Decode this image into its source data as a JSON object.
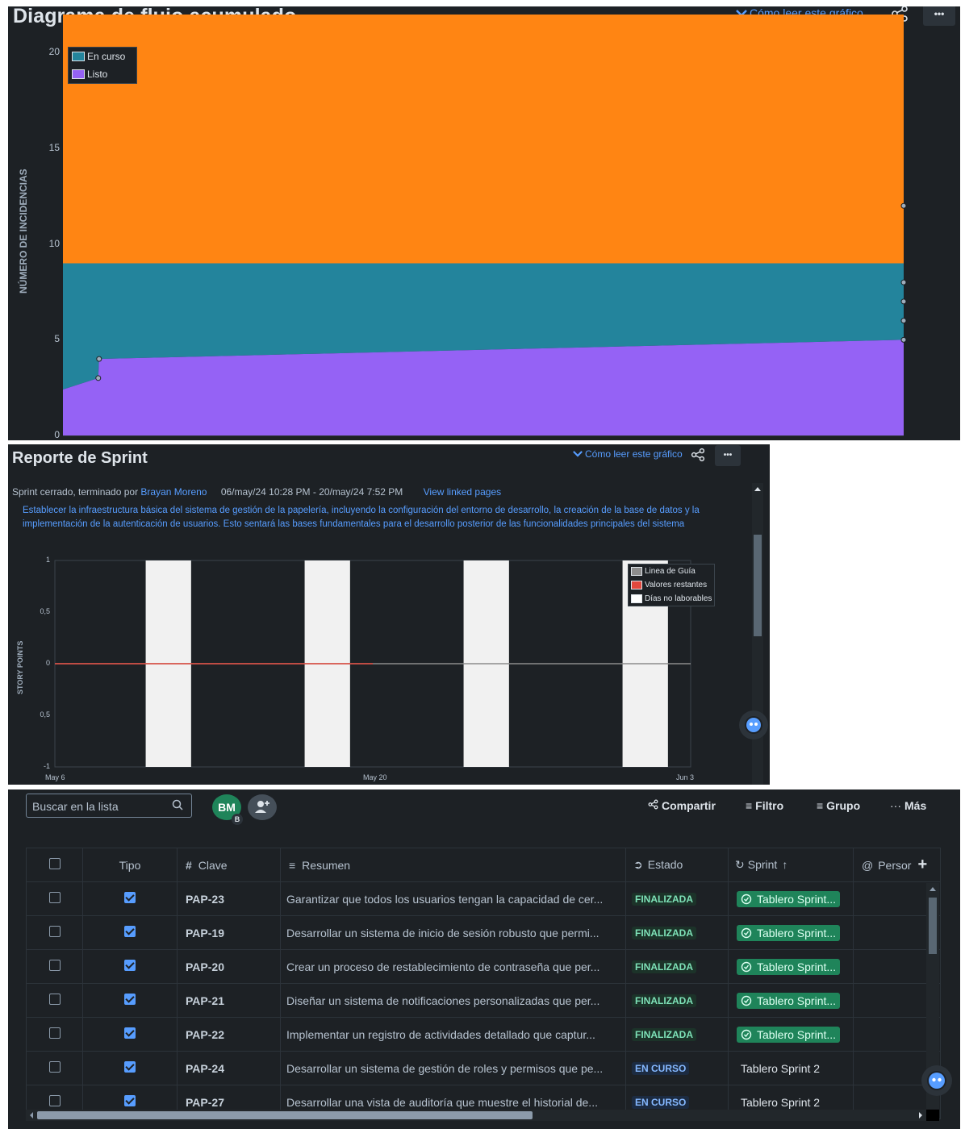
{
  "cfd": {
    "title": "Diagrama de flujo acumulado",
    "how_to_read": "Cómo leer este gráfico",
    "more_label": "•••",
    "ylabel": "NÚMERO DE INCIDENCIAS",
    "legend": [
      {
        "label": "En curso",
        "color": "#23849c"
      },
      {
        "label": "Listo",
        "color": "#9562f5"
      }
    ],
    "share_icon": "share-icon",
    "chart_data": {
      "type": "area",
      "ylabel": "NÚMERO DE INCIDENCIAS",
      "ylim": [
        0,
        22
      ],
      "yticks": [
        "0",
        "5",
        "10",
        "15",
        "20"
      ],
      "series": [
        {
          "name": "Listo",
          "color": "#9562f5",
          "values": [
            2.4,
            3,
            4,
            5
          ]
        },
        {
          "name": "En curso",
          "color": "#23849c",
          "values": [
            9,
            9,
            9,
            9
          ]
        },
        {
          "color": "#ff8513",
          "values": [
            22,
            22,
            22,
            22
          ]
        }
      ],
      "x_fraction": [
        0,
        0.042,
        0.043,
        1
      ],
      "stack_tops": {
        "listo": [
          2.4,
          3,
          4,
          5
        ],
        "en_curso": [
          9,
          9,
          9,
          9
        ],
        "top": [
          22,
          22,
          22,
          22
        ]
      },
      "grid": false,
      "legend_position": "top-left"
    }
  },
  "sprint_report": {
    "title": "Reporte de Sprint",
    "how_to_read": "Cómo leer este gráfico",
    "more_label": "•••",
    "status_prefix": "Sprint cerrado, terminado por",
    "closed_by": "Brayan Moreno",
    "dates": "06/may/24 10:28 PM - 20/may/24 7:52 PM",
    "linked_pages": "View linked pages",
    "goal": "Establecer la infraestructura básica del sistema de gestión de la papelería, incluyendo la configuración del entorno de desarrollo, la creación de la base de datos y la implementación de la autenticación de usuarios. Esto sentará las bases fundamentales para el desarrollo posterior de las funcionalidades principales del sistema",
    "ylabel": "STORY POINTS",
    "legend": [
      {
        "label": "Linea de Guía",
        "color": "#8c8c8c"
      },
      {
        "label": "Valores restantes",
        "color": "#e2483d"
      },
      {
        "label": "Días no laborables",
        "color": "#ffffff"
      }
    ],
    "chart_data": {
      "type": "line",
      "ylabel": "STORY POINTS",
      "ylim": [
        -1,
        1
      ],
      "yticks": [
        "1",
        "0,5",
        "0",
        "0,5",
        "-1"
      ],
      "xticks": [
        "May 6",
        "May 20",
        "Jun 3"
      ],
      "series": [
        {
          "name": "Linea de Guía",
          "color": "#8c8c8c",
          "x_start_days": 0,
          "x_end_days": 28,
          "values": [
            0,
            0
          ]
        },
        {
          "name": "Valores restantes",
          "color": "#e2483d",
          "x_start_days": 0,
          "x_end_days": 14,
          "values": [
            0,
            0
          ]
        }
      ],
      "non_working_days": [
        [
          4,
          6
        ],
        [
          11,
          13
        ],
        [
          18,
          20
        ],
        [
          25,
          27
        ]
      ],
      "x_range_days": [
        0,
        28
      ],
      "legend_position": "top-right"
    }
  },
  "issue_list": {
    "search_placeholder": "Buscar en la lista",
    "avatar_initials": "BM",
    "avatar_badge": "B",
    "toolbar": {
      "share": "Compartir",
      "filter": "Filtro",
      "group": "Grupo",
      "more": "Más"
    },
    "columns": {
      "type": "Tipo",
      "key": "Clave",
      "summary": "Resumen",
      "status": "Estado",
      "sprint": "Sprint",
      "person": "Persor"
    },
    "rows": [
      {
        "key": "PAP-23",
        "summary": "Garantizar que todos los usuarios tengan la capacidad de cer...",
        "status": "FINALIZADA",
        "sprint": "Tablero Sprint...",
        "done": true
      },
      {
        "key": "PAP-19",
        "summary": "Desarrollar un sistema de inicio de sesión robusto que permi...",
        "status": "FINALIZADA",
        "sprint": "Tablero Sprint...",
        "done": true
      },
      {
        "key": "PAP-20",
        "summary": "Crear un proceso de restablecimiento de contraseña que per...",
        "status": "FINALIZADA",
        "sprint": "Tablero Sprint...",
        "done": true
      },
      {
        "key": "PAP-21",
        "summary": "Diseñar un sistema de notificaciones personalizadas que per...",
        "status": "FINALIZADA",
        "sprint": "Tablero Sprint...",
        "done": true
      },
      {
        "key": "PAP-22",
        "summary": "Implementar un registro de actividades detallado que captur...",
        "status": "FINALIZADA",
        "sprint": "Tablero Sprint...",
        "done": true
      },
      {
        "key": "PAP-24",
        "summary": "Desarrollar un sistema de gestión de roles y permisos que pe...",
        "status": "EN CURSO",
        "sprint": "Tablero Sprint 2",
        "done": false
      },
      {
        "key": "PAP-27",
        "summary": "Desarrollar una vista de auditoría que muestre el historial de...",
        "status": "EN CURSO",
        "sprint": "Tablero Sprint 2",
        "done": false
      }
    ]
  }
}
